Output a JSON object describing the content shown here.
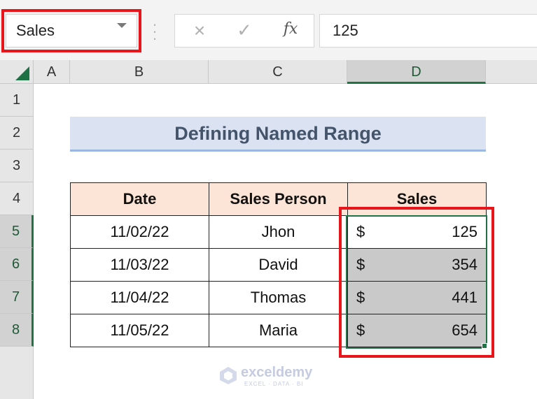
{
  "name_box": {
    "value": "Sales"
  },
  "formula_bar": {
    "cancel_icon": "×",
    "enter_icon": "✓",
    "fx_label": "fx",
    "formula": "125"
  },
  "columns": [
    "A",
    "B",
    "C",
    "D"
  ],
  "rows": [
    "1",
    "2",
    "3",
    "4",
    "5",
    "6",
    "7",
    "8"
  ],
  "title": "Defining Named Range",
  "table": {
    "headers": [
      "Date",
      "Sales Person",
      "Sales"
    ],
    "rows": [
      {
        "date": "11/02/22",
        "person": "Jhon",
        "currency": "$",
        "sales": "125"
      },
      {
        "date": "11/03/22",
        "person": "David",
        "currency": "$",
        "sales": "354"
      },
      {
        "date": "11/04/22",
        "person": "Thomas",
        "currency": "$",
        "sales": "441"
      },
      {
        "date": "11/05/22",
        "person": "Maria",
        "currency": "$",
        "sales": "654"
      }
    ]
  },
  "watermark": {
    "name": "exceldemy",
    "tagline": "EXCEL · DATA · BI"
  },
  "colors": {
    "excel_green": "#217346",
    "highlight_red": "#e8151b",
    "header_fill": "#fce4d6",
    "title_fill": "#dbe3f3"
  }
}
